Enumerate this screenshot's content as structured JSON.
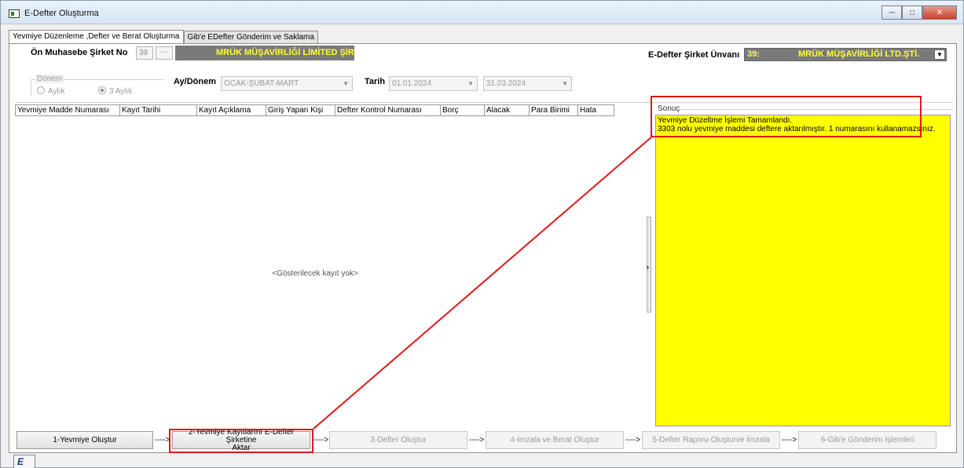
{
  "window": {
    "title": "E-Defter Oluşturma",
    "minimize_icon": "minimize-icon",
    "maximize_icon": "maximize-icon",
    "close_icon": "close-icon"
  },
  "tabs": [
    {
      "label": "Yevmiye Düzenleme ,Defter ve Berat Oluşturma"
    },
    {
      "label": "Gib'e EDefter Gönderim ve Saklama"
    }
  ],
  "header": {
    "company_no_label": "Ön Muhasebe Şirket No",
    "company_no_value": "39",
    "company_no_btn": "···",
    "company_name_short": "MRÜK MÜŞAVİRLİĞİ LİMİTED ŞİR",
    "edefter_label": "E-Defter Şirket Ünvanı",
    "edefter_value_prefix": "39:",
    "edefter_value_name": "MRÜK MÜŞAVİRLİĞİ LTD.ŞTİ."
  },
  "period": {
    "group_title": "Dönem",
    "option_monthly": "Aylık",
    "option_quarterly": "3 Aylık",
    "selected": "3 Aylık",
    "ay_donem_label": "Ay/Dönem",
    "ay_donem_value": "OCAK-ŞUBAT-MART",
    "tarih_label": "Tarih",
    "date_from": "01.01.2024",
    "date_to": "31.03.2024"
  },
  "grid": {
    "columns": [
      "Yevmiye Madde Numarası",
      "Kayıt Tarihi",
      "Kayıt Açıklama",
      "Giriş Yapan Kişi",
      "Defter Kontrol Numarası",
      "Borç",
      "Alacak",
      "Para Birimi",
      "Hata"
    ],
    "empty_text": "<Gösterilecek kayıt yok>"
  },
  "result": {
    "title": "Sonuç",
    "line1": "Yevmiye Düzeltme İşlemi Tamamlandı.",
    "line2": "3303 nolu yevmiye maddesi deftere aktarılmıştır. 1 numarasını kullanamazsınız.",
    "background": "#ffff00"
  },
  "steps": {
    "s1": "1-Yevmiye Oluştur",
    "s2a": "2-Yevmiye Kayıtlarını E-Defter Şirketine",
    "s2b": "Aktar",
    "s3": "3-Defter Oluştur",
    "s4": "4-İmzala ve Berat Oluştur",
    "s5": "5-Defter Raporu Oluşturve İmzala",
    "s6": "6-Gib'e Gönderim İşlemleri",
    "arrow": "---->"
  },
  "annotation_color": "#e01818"
}
